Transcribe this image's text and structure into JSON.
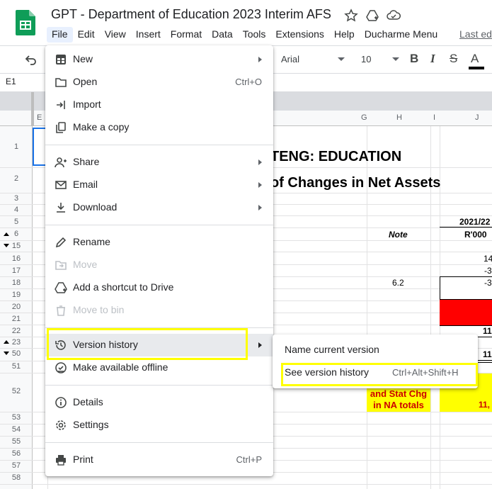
{
  "document": {
    "title": "GPT - Department of Education 2023 Interim AFS",
    "last_edit": "Last ed"
  },
  "menubar": [
    "File",
    "Edit",
    "View",
    "Insert",
    "Format",
    "Data",
    "Tools",
    "Extensions",
    "Help",
    "Ducharme Menu"
  ],
  "toolbar": {
    "font": "Arial",
    "font_size": "10",
    "bold": "B",
    "italic": "I",
    "strike": "S",
    "text_color": "A"
  },
  "formula_bar": {
    "name_box": "E1"
  },
  "columns": [
    "E",
    "G",
    "H",
    "I",
    "J"
  ],
  "rows": [
    "1",
    "2",
    "3",
    "4",
    "5",
    "6",
    "15",
    "16",
    "17",
    "18",
    "19",
    "20",
    "21",
    "22",
    "23",
    "50",
    "51",
    "52",
    "53",
    "54",
    "55",
    "56",
    "57",
    "58"
  ],
  "sheet": {
    "title1": "TENG: EDUCATION",
    "title2": "of Changes in Net Assets",
    "year": "2021/22",
    "note_header": "Note",
    "rand_header": "R'000",
    "note_ref": "6.2",
    "j16": "14",
    "j17": "-3",
    "j18": "-3",
    "j22": "11",
    "j50": "11",
    "h52_line1": "and Stat Chg",
    "h52_line2": "in NA totals",
    "j52": "11,"
  },
  "file_menu": {
    "new": "New",
    "open": "Open",
    "open_shortcut": "Ctrl+O",
    "import": "Import",
    "make_copy": "Make a copy",
    "share": "Share",
    "email": "Email",
    "download": "Download",
    "rename": "Rename",
    "move": "Move",
    "add_shortcut": "Add a shortcut to Drive",
    "move_to_bin": "Move to bin",
    "version_history": "Version history",
    "make_offline": "Make available offline",
    "details": "Details",
    "settings": "Settings",
    "print": "Print",
    "print_shortcut": "Ctrl+P"
  },
  "version_submenu": {
    "name_current": "Name current version",
    "see_history": "See version history",
    "see_history_shortcut": "Ctrl+Alt+Shift+H"
  },
  "colors": {
    "highlight": "#ffff00",
    "accent_blue": "#1a73e8",
    "sheets_green": "#0f9d58",
    "red_fill": "#ff0000"
  }
}
